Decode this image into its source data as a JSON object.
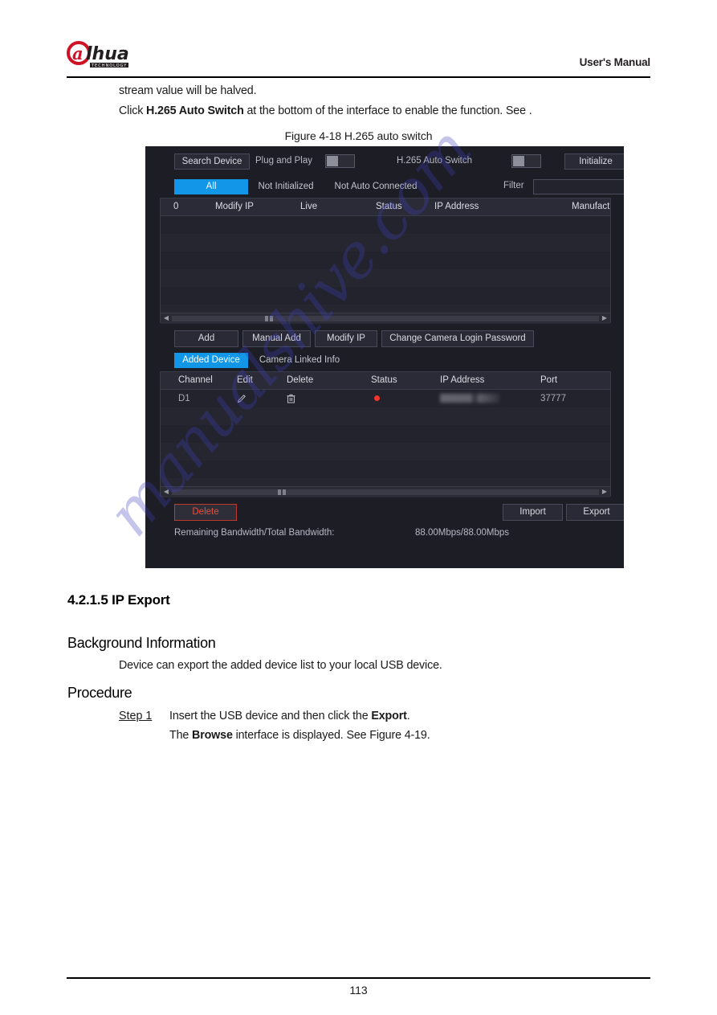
{
  "document": {
    "header_title": "User's Manual",
    "brand": "alhua",
    "brand_sub": "TECHNOLOGY",
    "page_number": "113"
  },
  "body": {
    "line1": "stream value will be halved.",
    "line2_pre": "Click ",
    "line2_bold": "H.265 Auto Switch",
    "line2_post": " at the bottom of the interface to enable the function. See .",
    "figure_caption": "Figure 4-18 H.265 auto switch",
    "section_number_title": "4.2.1.5 IP Export",
    "heading_background": "Background Information",
    "background_text": "Device can export the added device list to your local USB device.",
    "heading_procedure": "Procedure",
    "step1_label": "Step 1",
    "step1_pre": "Insert the USB device and then click the ",
    "step1_bold": "Export",
    "step1_post": ".",
    "step1_note_pre": "The ",
    "step1_note_bold": "Browse",
    "step1_note_post": " interface is displayed. See Figure 4-19."
  },
  "watermark": {
    "text": "manualshive.com"
  },
  "nvr": {
    "toolbar": {
      "search_device": "Search Device",
      "plug_and_play_label": "Plug and Play",
      "plug_and_play_state": "off",
      "h265_auto_switch_label": "H.265 Auto Switch",
      "h265_auto_switch_state": "off",
      "initialize": "Initialize"
    },
    "tabs": [
      {
        "label": "All",
        "active": true
      },
      {
        "label": "Not Initialized",
        "active": false
      },
      {
        "label": "Not Auto Connected",
        "active": false
      }
    ],
    "filter": {
      "label": "Filter",
      "value": "",
      "placeholder": ""
    },
    "search_table": {
      "columns": [
        "0",
        "Modify IP",
        "Live",
        "Status",
        "IP Address",
        "Manufact"
      ],
      "rows": []
    },
    "action_buttons": [
      "Add",
      "Manual Add",
      "Modify IP",
      "Change Camera Login Password"
    ],
    "lower_tabs": [
      {
        "label": "Added Device",
        "active": true
      },
      {
        "label": "Camera Linked Info",
        "active": false
      }
    ],
    "added_table": {
      "columns": [
        "Channel",
        "Edit",
        "Delete",
        "Status",
        "IP Address",
        "Port"
      ],
      "rows": [
        {
          "channel": "D1",
          "edit_icon": "pencil-icon",
          "delete_icon": "trash-icon",
          "status": "offline",
          "status_color": "#f2342c",
          "ip_address": "",
          "port": "37777"
        }
      ]
    },
    "footer": {
      "delete": "Delete",
      "import": "Import",
      "export": "Export",
      "bandwidth_label": "Remaining Bandwidth/Total Bandwidth:",
      "bandwidth_value": "88.00Mbps/88.00Mbps"
    },
    "colors": {
      "accent_blue": "#1296e8",
      "panel_bg": "#1d1d26",
      "list_bg": "#23232e",
      "danger_red": "#e8503f"
    }
  }
}
